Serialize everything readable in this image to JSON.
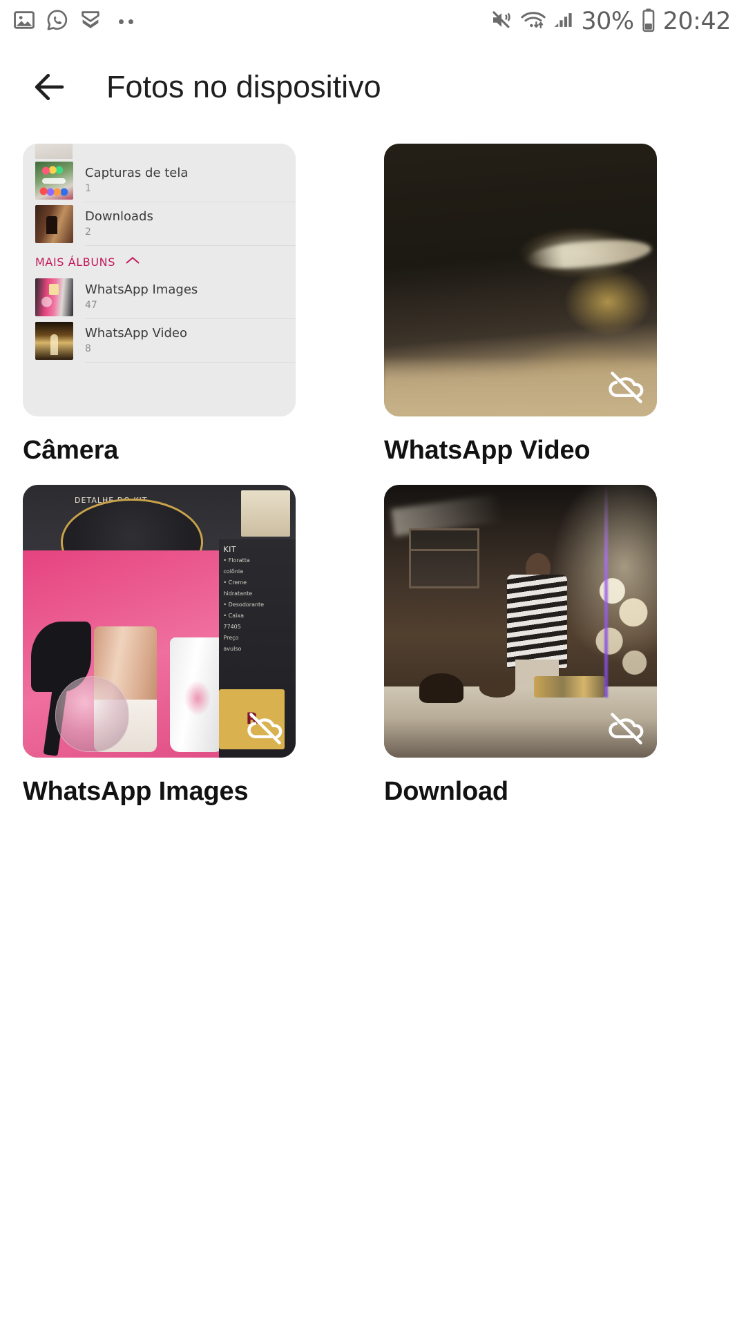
{
  "status_bar": {
    "left_icons": [
      "photo-icon",
      "whatsapp-icon",
      "double-chevron-down-icon",
      "more-dots-icon"
    ],
    "right_icons": [
      "volume-mute-vibrate-icon",
      "wifi-icon",
      "cellular-signal-icon",
      "battery-icon"
    ],
    "battery_percent": "30%",
    "time": "20:42"
  },
  "app_bar": {
    "back_icon": "back-arrow-icon",
    "title": "Fotos no dispositivo"
  },
  "colors": {
    "accent_pink": "#c2185b",
    "title_text": "#1f1f1f",
    "label_text": "#121212",
    "card_bg": "#eaeaea",
    "page_bg": "#ffffff"
  },
  "camera_card_list": {
    "rows": [
      {
        "name": "Capturas de tela",
        "count": "1",
        "art": "art-screenshot"
      },
      {
        "name": "Downloads",
        "count": "2",
        "art": "art-downloads"
      }
    ],
    "section": {
      "label": "MAIS ÁLBUNS",
      "chevron_icon": "chevron-up-icon"
    },
    "more_rows": [
      {
        "name": "WhatsApp Images",
        "count": "47",
        "art": "art-wa-images"
      },
      {
        "name": "WhatsApp Video",
        "count": "8",
        "art": "art-wa-video"
      }
    ]
  },
  "albums": [
    {
      "label": "Câmera",
      "badge": null
    },
    {
      "label": "WhatsApp Video",
      "badge": "cloud-off-icon"
    },
    {
      "label": "WhatsApp Images",
      "badge": "cloud-off-icon"
    },
    {
      "label": "Download",
      "badge": "cloud-off-icon"
    }
  ],
  "perfume_poster": {
    "caption": "DETALHE DO KIT",
    "kit_title": "KIT",
    "bullets": [
      "• Floratta",
      "colônia",
      "• Creme",
      "hidratante",
      "• Desodorante",
      "• Caixa"
    ],
    "code": "77405",
    "price_label": "Preço",
    "price_sub": "avulso",
    "badge": "R"
  }
}
